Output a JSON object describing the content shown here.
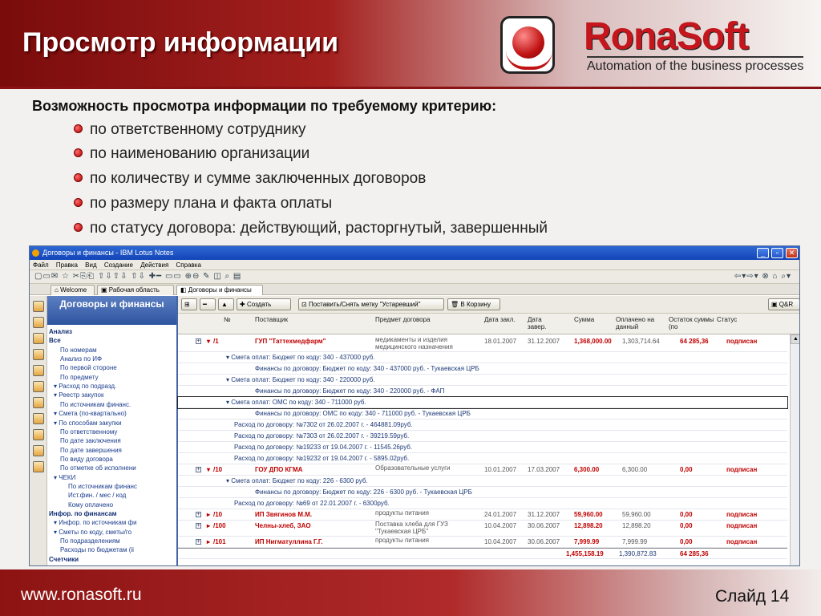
{
  "slide": {
    "title": "Просмотр информации",
    "brand_name": "RonaSoft",
    "brand_tagline": "Automation of the business processes",
    "lead": "Возможность просмотра информации по требуемому критерию:",
    "bullets": [
      "по ответственному сотруднику",
      "по наименованию организации",
      "по количеству и сумме заключенных договоров",
      "по размеру плана и факта оплаты",
      "по статусу договора: действующий, расторгнутый, завершенный"
    ],
    "footer_url": "www.ronasoft.ru",
    "footer_slide": "Слайд 14"
  },
  "app": {
    "window_title": "Договоры и финансы - IBM Lotus Notes",
    "menu": [
      "Файл",
      "Правка",
      "Вид",
      "Создание",
      "Действия",
      "Справка"
    ],
    "tabs": [
      "Welcome",
      "Рабочая область",
      "Договоры и финансы"
    ],
    "nav_title": "Договоры и финансы",
    "nav_items": [
      {
        "label": "Анализ",
        "type": "sec"
      },
      {
        "label": "Все",
        "type": "sec"
      },
      {
        "label": "По номерам",
        "type": "i1"
      },
      {
        "label": "Анализ по ИФ",
        "type": "i1"
      },
      {
        "label": "По первой стороне",
        "type": "i1"
      },
      {
        "label": "По предмету",
        "type": "i1"
      },
      {
        "label": "▾ Расход по подразд.",
        "type": "i0"
      },
      {
        "label": "▾ Реестр закупок",
        "type": "i0"
      },
      {
        "label": "По источникам финанс.",
        "type": "i1"
      },
      {
        "label": "▾ Смета (по-квартально)",
        "type": "i0"
      },
      {
        "label": "▾ По способам закупки",
        "type": "i0"
      },
      {
        "label": "По ответственному",
        "type": "i1"
      },
      {
        "label": "По дате заключения",
        "type": "i1"
      },
      {
        "label": "По дате завершения",
        "type": "i1"
      },
      {
        "label": "По виду договора",
        "type": "i1"
      },
      {
        "label": "По отметке об исполнени",
        "type": "i1"
      },
      {
        "label": "▾ ЧЕКИ",
        "type": "i0"
      },
      {
        "label": "По источникам финанс",
        "type": "i2"
      },
      {
        "label": "Ист.фин. / мес / код",
        "type": "i2"
      },
      {
        "label": "Кому оплачено",
        "type": "i2"
      },
      {
        "label": "Инфор. по финансам",
        "type": "sec"
      },
      {
        "label": "▾ Инфор. по источникам фи",
        "type": "i0"
      },
      {
        "label": "▾ Сметы по коду, сметы/го",
        "type": "i0"
      },
      {
        "label": "По подразделениям",
        "type": "i1"
      },
      {
        "label": "Расходы по бюджетам (ii",
        "type": "i1"
      },
      {
        "label": "Счетчики",
        "type": "sec"
      }
    ],
    "actions": {
      "create": "Создать",
      "mark": "Поставить/Снять метку \"Устаревший\"",
      "trash": "В Корзину",
      "qr": "Q&R"
    },
    "columns": [
      "№",
      "Поставщик",
      "Предмет договора",
      "Дата закл.",
      "Дата завер.",
      "Сумма",
      "Оплачено на данный",
      "Остаток суммы (по",
      "Статус"
    ],
    "rows": [
      {
        "kind": "main",
        "num": "/1",
        "supplier": "ГУП \"Таттехмедфарм\"",
        "subject": "медикаменты и изделия медицинского назначения",
        "date1": "18.01.2007",
        "date2": "31.12.2007",
        "sum": "1,368,000.00",
        "paid": "1,303,714.64",
        "rest": "64 285,36",
        "status": "подписан"
      },
      {
        "kind": "l1",
        "text": "▾ Смета оплат:  Бюджет по коду: 340 - 437000 руб."
      },
      {
        "kind": "l2",
        "text": "Финансы по договору: Бюджет по коду: 340 - 437000 руб. - Тукаевская ЦРБ"
      },
      {
        "kind": "l1",
        "text": "▾ Смета оплат:  Бюджет по коду: 340 - 220000 руб."
      },
      {
        "kind": "l2",
        "text": "Финансы по договору: Бюджет по коду: 340 - 220000 руб. - ФАП"
      },
      {
        "kind": "l1",
        "text": "▾ Смета оплат:  ОМС по коду: 340 - 711000 руб.",
        "selected": true
      },
      {
        "kind": "l2",
        "text": "Финансы по договору: ОМС по коду: 340 - 711000 руб. - Тукаевская ЦРБ"
      },
      {
        "kind": "l1b",
        "text": "Расход по договору: №7302 от 26.02.2007 г. - 464881.09руб."
      },
      {
        "kind": "l1b",
        "text": "Расход по договору: №7303 от 26.02.2007 г. - 39219.59руб."
      },
      {
        "kind": "l1b",
        "text": "Расход по договору: №19233 от 19.04.2007 г. - 11545.26руб."
      },
      {
        "kind": "l1b",
        "text": "Расход по договору: №19232 от 19.04.2007 г. - 5895.02руб."
      },
      {
        "kind": "main",
        "num": "/10",
        "supplier": "ГОУ ДПО КГМА",
        "subject": "Образовательные услуги",
        "date1": "10.01.2007",
        "date2": "17.03.2007",
        "sum": "6,300.00",
        "paid": "6,300.00",
        "rest": "0,00",
        "status": "подписан"
      },
      {
        "kind": "l1",
        "text": "▾ Смета оплат:  Бюджет по коду: 226 - 6300 руб."
      },
      {
        "kind": "l2",
        "text": "Финансы по договору: Бюджет по коду: 226 - 6300 руб. - Тукаевская ЦРБ"
      },
      {
        "kind": "l1b",
        "text": "Расход по договору: №69 от 22.01.2007 г. - 6300руб."
      },
      {
        "kind": "main2",
        "num": "/10",
        "supplier": "ИП Звягинов М.М.",
        "subject": "продукты питания",
        "date1": "24.01.2007",
        "date2": "31.12.2007",
        "sum": "59,960.00",
        "paid": "59,960.00",
        "rest": "0,00",
        "status": "подписан"
      },
      {
        "kind": "main2",
        "num": "/100",
        "supplier": "Челны-хлеб, ЗАО",
        "subject": "Поставка хлеба для ГУЗ \"Тукаевская ЦРБ\"",
        "date1": "10.04.2007",
        "date2": "30.06.2007",
        "sum": "12,898.20",
        "paid": "12,898.20",
        "rest": "0,00",
        "status": "подписан"
      },
      {
        "kind": "main2",
        "num": "/101",
        "supplier": "ИП Нигматуллина Г.Г.",
        "subject": "продукты питания",
        "date1": "10.04.2007",
        "date2": "30.06.2007",
        "sum": "7,999.99",
        "paid": "7,999.99",
        "rest": "0,00",
        "status": "подписан"
      }
    ],
    "totals": {
      "sum": "1,455,158.19",
      "paid": "1,390,872.83",
      "rest": "64 285,36"
    }
  }
}
